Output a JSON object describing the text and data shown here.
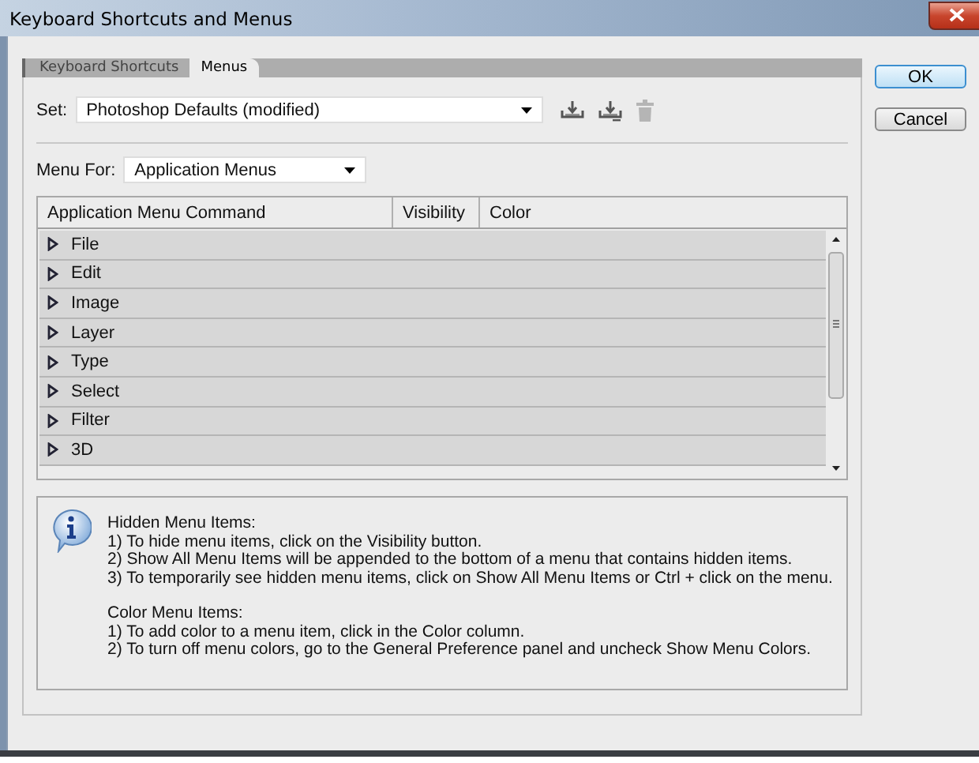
{
  "window": {
    "title": "Keyboard Shortcuts and Menus"
  },
  "tabs": [
    {
      "label": "Keyboard Shortcuts",
      "selected": false
    },
    {
      "label": "Menus",
      "selected": true
    }
  ],
  "set": {
    "label": "Set:",
    "value": "Photoshop Defaults (modified)"
  },
  "set_actions": [
    {
      "kind": "save",
      "disabled": false
    },
    {
      "kind": "save-as",
      "disabled": false
    },
    {
      "kind": "delete",
      "disabled": true
    }
  ],
  "menu_for": {
    "label": "Menu For:",
    "value": "Application Menus"
  },
  "table": {
    "columns": [
      "Application Menu Command",
      "Visibility",
      "Color"
    ],
    "rows": [
      {
        "label": "File",
        "expanded": false
      },
      {
        "label": "Edit",
        "expanded": false
      },
      {
        "label": "Image",
        "expanded": false
      },
      {
        "label": "Layer",
        "expanded": false
      },
      {
        "label": "Type",
        "expanded": false
      },
      {
        "label": "Select",
        "expanded": false
      },
      {
        "label": "Filter",
        "expanded": false
      },
      {
        "label": "3D",
        "expanded": false
      }
    ]
  },
  "info": [
    {
      "heading": "Hidden Menu Items:",
      "lines": [
        "1) To hide menu items, click on the Visibility button.",
        "2) Show All Menu Items will be appended to the bottom of a menu that contains hidden items.",
        "3) To temporarily see hidden menu items, click on Show All Menu Items or Ctrl + click on the menu."
      ]
    },
    {
      "heading": "Color Menu Items:",
      "lines": [
        "1) To add color to a menu item, click in the Color column.",
        "2) To turn off menu colors, go to the General Preference panel and uncheck Show Menu Colors."
      ]
    }
  ],
  "buttons": [
    {
      "label": "OK",
      "default": true
    },
    {
      "label": "Cancel",
      "default": false
    }
  ]
}
